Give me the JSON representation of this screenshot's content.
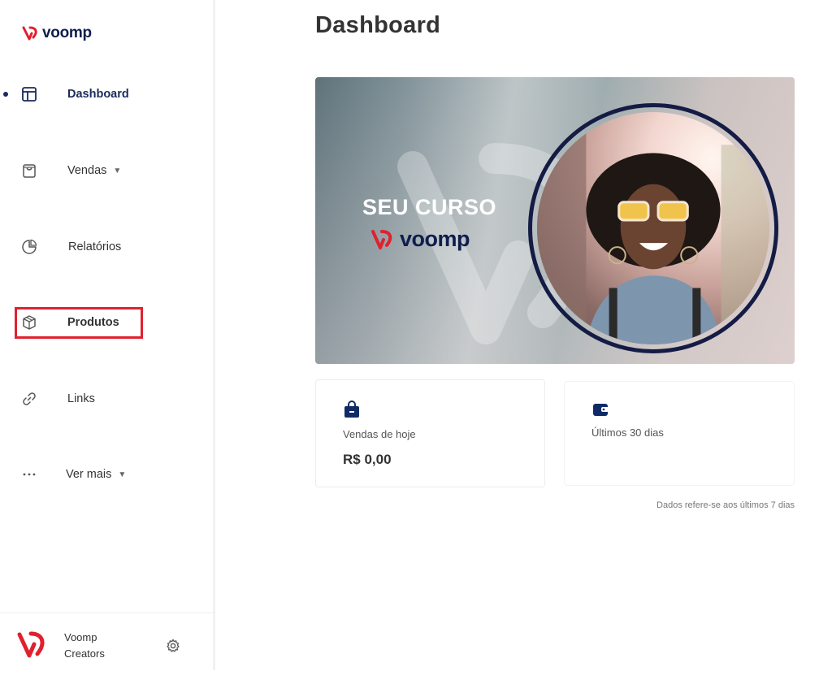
{
  "brand": {
    "name": "voomp",
    "primary_color": "#1b2b5e",
    "accent_color": "#e0212e"
  },
  "sidebar": {
    "items": [
      {
        "label": "Dashboard",
        "icon": "layout-icon",
        "active": true
      },
      {
        "label": "Vendas",
        "icon": "shopping-bag-icon",
        "dropdown": true
      },
      {
        "label": "Relatórios",
        "icon": "pie-chart-icon"
      },
      {
        "label": "Produtos",
        "icon": "box-icon",
        "highlighted": true
      },
      {
        "label": "Links",
        "icon": "link-icon"
      },
      {
        "label": "Ver mais",
        "icon": "more-dots-icon",
        "dropdown": true
      }
    ],
    "footer": {
      "name_line1": "Voomp",
      "name_line2": "Creators",
      "settings_icon": "gear-icon"
    }
  },
  "main": {
    "title": "Dashboard",
    "banner": {
      "headline": "SEU CURSO",
      "brand": "voomp"
    },
    "cards": [
      {
        "label": "Vendas de hoje",
        "value": "R$ 0,00",
        "icon": "bag-icon"
      },
      {
        "label": "Últimos 30 dias",
        "value": "",
        "icon": "wallet-icon"
      }
    ],
    "footnote": "Dados refere-se aos últimos 7 dias"
  }
}
